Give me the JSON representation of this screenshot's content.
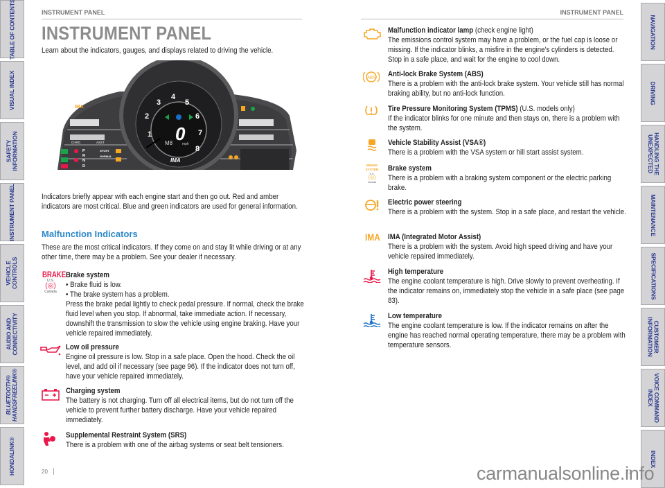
{
  "left_tabs": [
    "TABLE OF CONTENTS",
    "VISUAL INDEX",
    "SAFETY\nINFORMATION",
    "INSTRUMENT PANEL",
    "VEHICLE\nCONTROLS",
    "AUDIO AND\nCONNECTIVITY",
    "BLUETOOTH®\nHANDSFREELINK®",
    "HONDALINK®"
  ],
  "right_tabs": [
    "NAVIGATION",
    "DRIVING",
    "HANDLING THE\nUNEXPECTED",
    "MAINTENANCE",
    "SPECIFICATIONS",
    "CUSTOMER\nINFORMATION",
    "VOICE COMMAND\nINDEX",
    "INDEX"
  ],
  "left_page": {
    "running_head": "INSTRUMENT PANEL",
    "title": "INSTRUMENT PANEL",
    "intro": "Learn about the indicators, gauges, and displays related to driving the vehicle.",
    "indicators_para": "Indicators briefly appear with each engine start and then go out. Red and amber indicators are most critical. Blue and green indicators are used for general information.",
    "section_heading": "Malfunction Indicators",
    "section_para": "These are the most critical indicators. If they come on and stay lit while driving or at any other time, there may be a problem. See your dealer if necessary.",
    "brake_icon": {
      "us_label": "BRAKE",
      "us": "U.S.",
      "canada": "Canada"
    },
    "items": [
      {
        "icon": "brake-icon",
        "title": "Brake system",
        "text": "• Brake fluid is low.\n• The brake system has a problem.\nPress the brake pedal lightly to check pedal pressure. If normal, check the brake fluid level when you stop. If abnormal, take immediate action. If necessary, downshift the transmission to slow the vehicle using engine braking. Have your vehicle repaired immediately."
      },
      {
        "icon": "oil-can-icon",
        "title": "Low oil pressure",
        "text": "Engine oil pressure is low. Stop in a safe place. Open the hood. Check the oil level, and add oil if necessary (see page 96). If the indicator does not turn off, have your vehicle repaired immediately."
      },
      {
        "icon": "battery-icon",
        "title": "Charging system",
        "text": "The battery is not charging. Turn off all electrical items, but do not turn off the vehicle to prevent further battery discharge. Have your vehicle repaired immediately."
      },
      {
        "icon": "airbag-icon",
        "title": "Supplemental Restraint System (SRS)",
        "text": "There is a problem with one of the airbag systems or seat belt tensioners."
      }
    ],
    "page_number": "20"
  },
  "right_page": {
    "running_head": "INSTRUMENT PANEL",
    "items": [
      {
        "icon": "check-engine-icon",
        "title": "Malfunction indicator lamp",
        "note": " (check engine light)",
        "text": "The emissions control system may have a problem, or the fuel cap is loose or missing. If the indicator blinks, a misfire in the engine’s cylinders is detected. Stop in a safe place, and wait for the engine to cool down."
      },
      {
        "icon": "abs-icon",
        "title": "Anti-lock Brake System (ABS)",
        "note": "",
        "text": "There is a problem with the anti-lock brake system. Your vehicle still has normal braking ability, but no anti-lock function."
      },
      {
        "icon": "tpms-icon",
        "title": "Tire Pressure Monitoring System (TPMS)",
        "note": " (U.S. models only)",
        "text": "If the indicator blinks for one minute and then stays on, there is a problem with the system."
      },
      {
        "icon": "vsa-icon",
        "title": "Vehicle Stability Assist (VSA®)",
        "note": "",
        "text": "There is a problem with the VSA system or hill start assist system."
      },
      {
        "icon": "brake-system-icon",
        "title": "Brake system",
        "note": "",
        "text": "There is a problem with a braking system component or the electric parking brake."
      },
      {
        "icon": "steering-icon",
        "title": "Electric power steering",
        "note": "",
        "text": "There is a problem with the system. Stop in a safe place, and restart the vehicle."
      },
      {
        "icon": "ima-icon",
        "title": "IMA (Integrated Motor Assist)",
        "note": "",
        "text": "There is a problem with the system. Avoid high speed driving and have your vehicle repaired immediately."
      },
      {
        "icon": "high-temp-icon",
        "title": "High temperature",
        "note": "",
        "text": "The engine coolant temperature is high. Drive slowly to prevent overheating. If the indicator remains on, immediately stop the vehicle in a safe place (see page 83)."
      },
      {
        "icon": "low-temp-icon",
        "title": "Low temperature",
        "note": "",
        "text": "The engine coolant temperature is low. If the indicator remains on after the engine has reached normal operating temperature, there may be a problem with temperature sensors."
      }
    ],
    "brake_system_icon": {
      "label": "BRAKE SYSTEM",
      "us": "U.S.",
      "canada": "Canada"
    },
    "ima_label": "IMA",
    "page_number": "21"
  },
  "dashboard": {
    "speed": "0",
    "unit": "mph",
    "gear": "M8",
    "tach_labels": [
      "1",
      "2",
      "3",
      "4",
      "5",
      "6",
      "7",
      "8"
    ],
    "brand": "IMA",
    "chrg": "CHRG",
    "asst": "ASST",
    "modes": [
      "SPORT",
      "NORMAL"
    ],
    "prnd": [
      "P",
      "R",
      "N",
      "D"
    ]
  },
  "colors": {
    "tab_text": "#2b3990",
    "heading_blue": "#2a88c8",
    "red": "#e8194a",
    "amber": "#f5a623",
    "blue": "#1a6fc4"
  },
  "watermark": "carmanualsonline.info"
}
